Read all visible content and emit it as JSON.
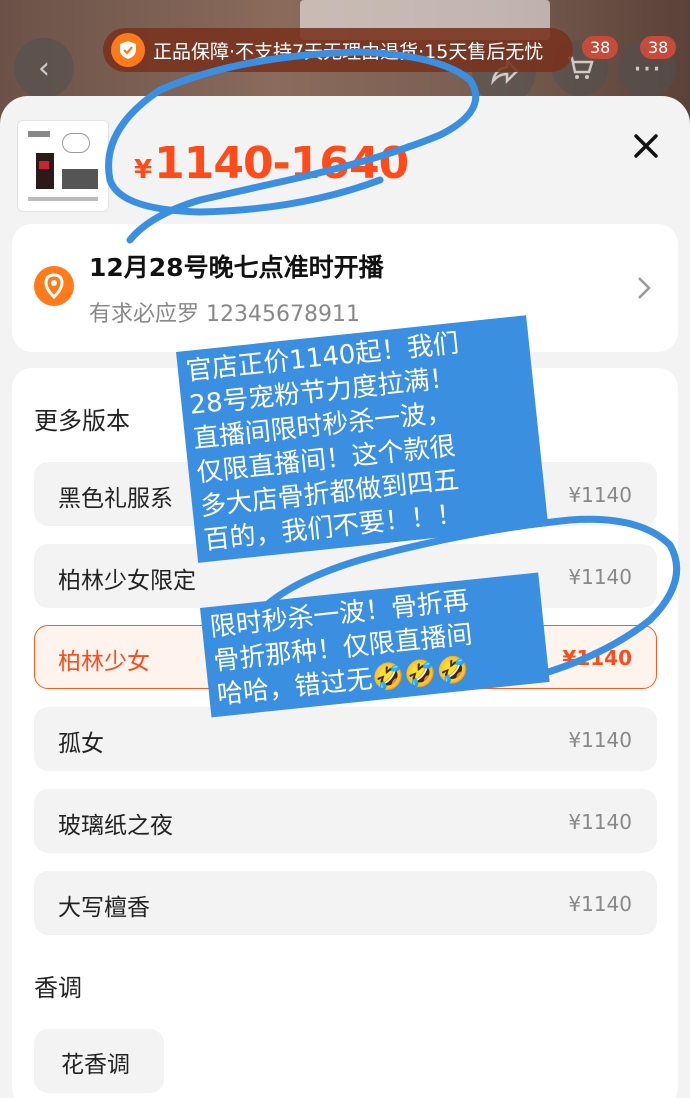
{
  "background": {
    "badges": [
      "38",
      "38"
    ]
  },
  "guarantee": {
    "text": "正品保障·不支持7天无理由退货·15天售后无忧"
  },
  "product": {
    "currency": "¥",
    "price_range": "1140-1640"
  },
  "live": {
    "title": "12月28号晚七点准时开播",
    "subtitle": "有求必应罗 12345678911"
  },
  "versions": {
    "title": "更多版本",
    "options": [
      {
        "label": "黑色礼服系",
        "price": "¥1140",
        "selected": false
      },
      {
        "label": "柏林少女限定",
        "price": "¥1140",
        "selected": false
      },
      {
        "label": "柏林少女",
        "price": "¥1140",
        "selected": true
      },
      {
        "label": "孤女",
        "price": "¥1140",
        "selected": false
      },
      {
        "label": "玻璃纸之夜",
        "price": "¥1140",
        "selected": false
      },
      {
        "label": "大写檀香",
        "price": "¥1140",
        "selected": false
      }
    ]
  },
  "scent": {
    "title": "香调",
    "options": [
      "花香调"
    ]
  },
  "annotations": {
    "note1_lines": [
      "官店正价1140起！我们",
      "28号宠粉节力度拉满！",
      "直播间限时秒杀一波，",
      "仅限直播间！这个款很",
      "多大店骨折都做到四五",
      "百的，我们不要！！！"
    ],
    "note2_lines": [
      "限时秒杀一波！骨折再",
      "骨折那种！仅限直播间",
      "哈哈，错过无🤣🤣🤣"
    ]
  },
  "colors": {
    "accent": "#ff4a1a",
    "annotation": "#3a8fe0"
  },
  "icons": [
    "back-icon",
    "share-icon",
    "cart-icon",
    "more-icon",
    "shield-check-icon",
    "close-icon",
    "location-pin-icon",
    "chevron-right-icon"
  ]
}
